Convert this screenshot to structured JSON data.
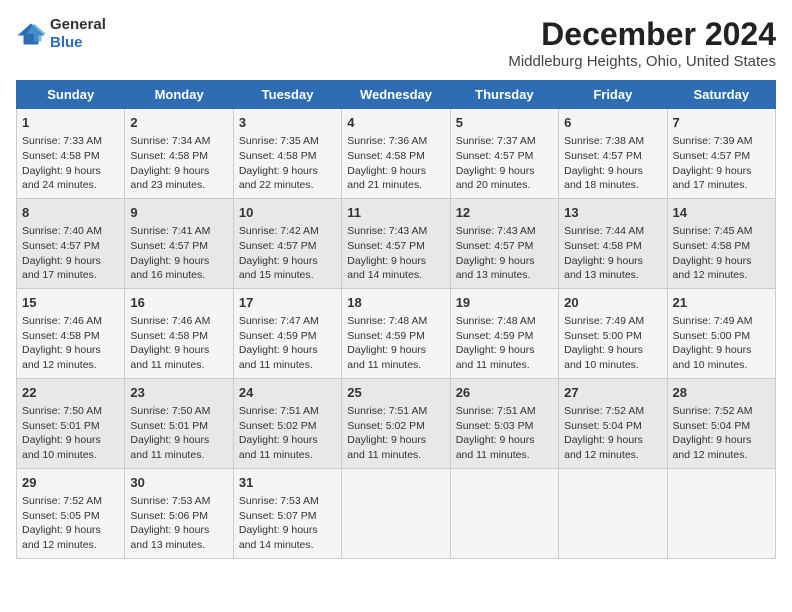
{
  "logo": {
    "text_general": "General",
    "text_blue": "Blue"
  },
  "title": "December 2024",
  "subtitle": "Middleburg Heights, Ohio, United States",
  "days_of_week": [
    "Sunday",
    "Monday",
    "Tuesday",
    "Wednesday",
    "Thursday",
    "Friday",
    "Saturday"
  ],
  "weeks": [
    [
      {
        "day": "1",
        "sunrise": "Sunrise: 7:33 AM",
        "sunset": "Sunset: 4:58 PM",
        "daylight": "Daylight: 9 hours and 24 minutes."
      },
      {
        "day": "2",
        "sunrise": "Sunrise: 7:34 AM",
        "sunset": "Sunset: 4:58 PM",
        "daylight": "Daylight: 9 hours and 23 minutes."
      },
      {
        "day": "3",
        "sunrise": "Sunrise: 7:35 AM",
        "sunset": "Sunset: 4:58 PM",
        "daylight": "Daylight: 9 hours and 22 minutes."
      },
      {
        "day": "4",
        "sunrise": "Sunrise: 7:36 AM",
        "sunset": "Sunset: 4:58 PM",
        "daylight": "Daylight: 9 hours and 21 minutes."
      },
      {
        "day": "5",
        "sunrise": "Sunrise: 7:37 AM",
        "sunset": "Sunset: 4:57 PM",
        "daylight": "Daylight: 9 hours and 20 minutes."
      },
      {
        "day": "6",
        "sunrise": "Sunrise: 7:38 AM",
        "sunset": "Sunset: 4:57 PM",
        "daylight": "Daylight: 9 hours and 18 minutes."
      },
      {
        "day": "7",
        "sunrise": "Sunrise: 7:39 AM",
        "sunset": "Sunset: 4:57 PM",
        "daylight": "Daylight: 9 hours and 17 minutes."
      }
    ],
    [
      {
        "day": "8",
        "sunrise": "Sunrise: 7:40 AM",
        "sunset": "Sunset: 4:57 PM",
        "daylight": "Daylight: 9 hours and 17 minutes."
      },
      {
        "day": "9",
        "sunrise": "Sunrise: 7:41 AM",
        "sunset": "Sunset: 4:57 PM",
        "daylight": "Daylight: 9 hours and 16 minutes."
      },
      {
        "day": "10",
        "sunrise": "Sunrise: 7:42 AM",
        "sunset": "Sunset: 4:57 PM",
        "daylight": "Daylight: 9 hours and 15 minutes."
      },
      {
        "day": "11",
        "sunrise": "Sunrise: 7:43 AM",
        "sunset": "Sunset: 4:57 PM",
        "daylight": "Daylight: 9 hours and 14 minutes."
      },
      {
        "day": "12",
        "sunrise": "Sunrise: 7:43 AM",
        "sunset": "Sunset: 4:57 PM",
        "daylight": "Daylight: 9 hours and 13 minutes."
      },
      {
        "day": "13",
        "sunrise": "Sunrise: 7:44 AM",
        "sunset": "Sunset: 4:58 PM",
        "daylight": "Daylight: 9 hours and 13 minutes."
      },
      {
        "day": "14",
        "sunrise": "Sunrise: 7:45 AM",
        "sunset": "Sunset: 4:58 PM",
        "daylight": "Daylight: 9 hours and 12 minutes."
      }
    ],
    [
      {
        "day": "15",
        "sunrise": "Sunrise: 7:46 AM",
        "sunset": "Sunset: 4:58 PM",
        "daylight": "Daylight: 9 hours and 12 minutes."
      },
      {
        "day": "16",
        "sunrise": "Sunrise: 7:46 AM",
        "sunset": "Sunset: 4:58 PM",
        "daylight": "Daylight: 9 hours and 11 minutes."
      },
      {
        "day": "17",
        "sunrise": "Sunrise: 7:47 AM",
        "sunset": "Sunset: 4:59 PM",
        "daylight": "Daylight: 9 hours and 11 minutes."
      },
      {
        "day": "18",
        "sunrise": "Sunrise: 7:48 AM",
        "sunset": "Sunset: 4:59 PM",
        "daylight": "Daylight: 9 hours and 11 minutes."
      },
      {
        "day": "19",
        "sunrise": "Sunrise: 7:48 AM",
        "sunset": "Sunset: 4:59 PM",
        "daylight": "Daylight: 9 hours and 11 minutes."
      },
      {
        "day": "20",
        "sunrise": "Sunrise: 7:49 AM",
        "sunset": "Sunset: 5:00 PM",
        "daylight": "Daylight: 9 hours and 10 minutes."
      },
      {
        "day": "21",
        "sunrise": "Sunrise: 7:49 AM",
        "sunset": "Sunset: 5:00 PM",
        "daylight": "Daylight: 9 hours and 10 minutes."
      }
    ],
    [
      {
        "day": "22",
        "sunrise": "Sunrise: 7:50 AM",
        "sunset": "Sunset: 5:01 PM",
        "daylight": "Daylight: 9 hours and 10 minutes."
      },
      {
        "day": "23",
        "sunrise": "Sunrise: 7:50 AM",
        "sunset": "Sunset: 5:01 PM",
        "daylight": "Daylight: 9 hours and 11 minutes."
      },
      {
        "day": "24",
        "sunrise": "Sunrise: 7:51 AM",
        "sunset": "Sunset: 5:02 PM",
        "daylight": "Daylight: 9 hours and 11 minutes."
      },
      {
        "day": "25",
        "sunrise": "Sunrise: 7:51 AM",
        "sunset": "Sunset: 5:02 PM",
        "daylight": "Daylight: 9 hours and 11 minutes."
      },
      {
        "day": "26",
        "sunrise": "Sunrise: 7:51 AM",
        "sunset": "Sunset: 5:03 PM",
        "daylight": "Daylight: 9 hours and 11 minutes."
      },
      {
        "day": "27",
        "sunrise": "Sunrise: 7:52 AM",
        "sunset": "Sunset: 5:04 PM",
        "daylight": "Daylight: 9 hours and 12 minutes."
      },
      {
        "day": "28",
        "sunrise": "Sunrise: 7:52 AM",
        "sunset": "Sunset: 5:04 PM",
        "daylight": "Daylight: 9 hours and 12 minutes."
      }
    ],
    [
      {
        "day": "29",
        "sunrise": "Sunrise: 7:52 AM",
        "sunset": "Sunset: 5:05 PM",
        "daylight": "Daylight: 9 hours and 12 minutes."
      },
      {
        "day": "30",
        "sunrise": "Sunrise: 7:53 AM",
        "sunset": "Sunset: 5:06 PM",
        "daylight": "Daylight: 9 hours and 13 minutes."
      },
      {
        "day": "31",
        "sunrise": "Sunrise: 7:53 AM",
        "sunset": "Sunset: 5:07 PM",
        "daylight": "Daylight: 9 hours and 14 minutes."
      },
      null,
      null,
      null,
      null
    ]
  ]
}
